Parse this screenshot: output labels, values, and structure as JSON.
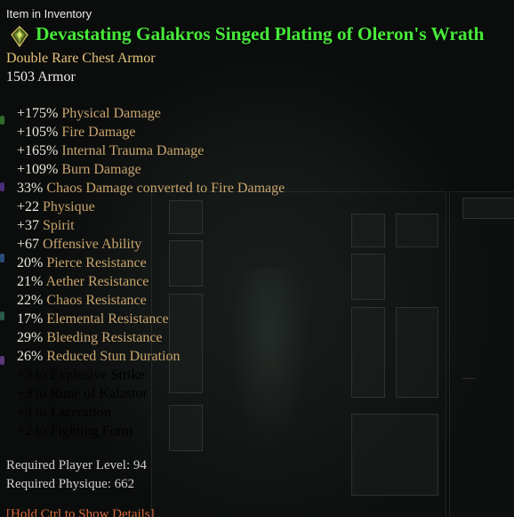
{
  "tooltip": {
    "header": "Item in Inventory",
    "icon": "rare-armor-gem-icon",
    "title": "Devastating Galakros Singed Plating of Oleron's Wrath",
    "item_type": "Double Rare Chest Armor",
    "armor": "1503 Armor",
    "stats": [
      {
        "value": "+175%",
        "text": " Physical Damage"
      },
      {
        "value": "+105%",
        "text": " Fire Damage"
      },
      {
        "value": "+165%",
        "text": " Internal Trauma Damage"
      },
      {
        "value": "+109%",
        "text": " Burn Damage"
      },
      {
        "value": "33%",
        "text": " Chaos Damage converted to Fire Damage"
      },
      {
        "value": "+22",
        "text": " Physique"
      },
      {
        "value": "+37",
        "text": " Spirit"
      },
      {
        "value": "+67",
        "text": " Offensive Ability"
      },
      {
        "value": "20%",
        "text": " Pierce Resistance"
      },
      {
        "value": "21%",
        "text": " Aether Resistance"
      },
      {
        "value": "22%",
        "text": " Chaos Resistance"
      },
      {
        "value": "17%",
        "text": " Elemental Resistance"
      },
      {
        "value": "29%",
        "text": " Bleeding Resistance"
      },
      {
        "value": "26%",
        "text": " Reduced Stun Duration"
      }
    ],
    "skills": [
      "+3 to Explosive Strike",
      "+3 to Rune of Kalastor",
      "+3 to Laceration",
      "+2 to Fighting Form"
    ],
    "requirements": {
      "level": "Required Player Level: 94",
      "physique": "Required Physique: 662"
    },
    "hint": "[Hold Ctrl to Show Details]"
  },
  "colors": {
    "title": "#47e83a",
    "item_type": "#e7c27a",
    "stat_text": "#c9a46e",
    "hint": "#d86a3c"
  }
}
